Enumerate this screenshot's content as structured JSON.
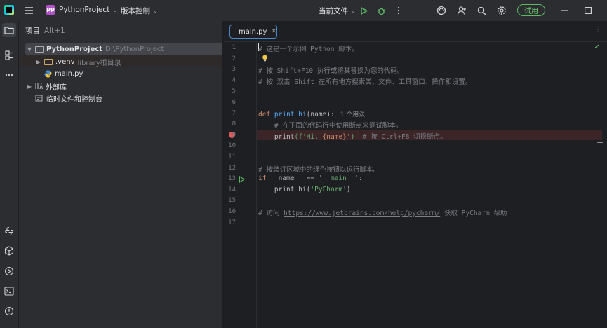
{
  "topbar": {
    "project_badge": "PP",
    "project_name": "PythonProject",
    "vcs_label": "版本控制",
    "run_config": "当前文件",
    "trial_label": "试用"
  },
  "project_panel": {
    "title": "项目",
    "shortcut": "Alt+1",
    "tree": [
      {
        "label": "PythonProject",
        "sub": "D:\\PythonProject"
      },
      {
        "label": ".venv",
        "sub": "library根目录"
      },
      {
        "label": "main.py",
        "sub": ""
      },
      {
        "label": "外部库",
        "sub": ""
      },
      {
        "label": "临时文件和控制台",
        "sub": ""
      }
    ]
  },
  "editor": {
    "tab": "main.py",
    "line_numbers": [
      "1",
      "2",
      "3",
      "4",
      "5",
      "6",
      "7",
      "8",
      "9",
      "10",
      "11",
      "12",
      "13",
      "14",
      "15",
      "16",
      "17"
    ],
    "lines": {
      "l1": "# 这是一个示例 Python 脚本。",
      "l3": "# 按 Shift+F10 执行或将其替换为您的代码。",
      "l4": "# 按 双击 Shift 在所有地方搜索类、文件、工具窗口、操作和设置。",
      "l7_kw": "def",
      "l7_fn": "print_hi",
      "l7_rest": "(name):",
      "l7_hint": "1 个用法",
      "l8": "    # 在下面的代码行中使用断点来调试脚本。",
      "l9_fn": "print",
      "l9_open": "(f'",
      "l9_str1": "Hi, ",
      "l9_mid": "{name}",
      "l9_close": "')",
      "l9_cm": "  # 按 Ctrl+F8 切换断点。",
      "l12": "# 按装订区域中的绿色按钮以运行脚本。",
      "l13_kw": "if",
      "l13_mid": " __name__ == ",
      "l13_str": "'__main__'",
      "l13_end": ":",
      "l14_fn": "print_hi",
      "l14_open": "(",
      "l14_str": "'PyCharm'",
      "l14_close": ")",
      "l16_cm": "# 访问 ",
      "l16_link": "https://www.jetbrains.com/help/pycharm/",
      "l16_end": " 获取 PyCharm 帮助"
    }
  },
  "colors": {
    "accent": "#4a88c7",
    "breakpoint": "#db5c5c",
    "run": "#5fb865",
    "keyword": "#cf8e6d",
    "function": "#56a8f5",
    "string": "#6aab73",
    "comment": "#7a7e85"
  },
  "icons": [
    "pycharm-logo-icon",
    "hamburger-menu-icon",
    "run-icon",
    "debug-icon",
    "more-vertical-icon",
    "copilot-icon",
    "add-user-icon",
    "search-icon",
    "settings-icon",
    "minimize-icon",
    "maximize-icon",
    "folder-icon",
    "structure-icon",
    "more-horizontal-icon",
    "python-console-icon",
    "python-packages-icon",
    "services-icon",
    "terminal-icon",
    "problems-icon",
    "breakpoint-icon",
    "intention-bulb-icon",
    "check-icon"
  ]
}
